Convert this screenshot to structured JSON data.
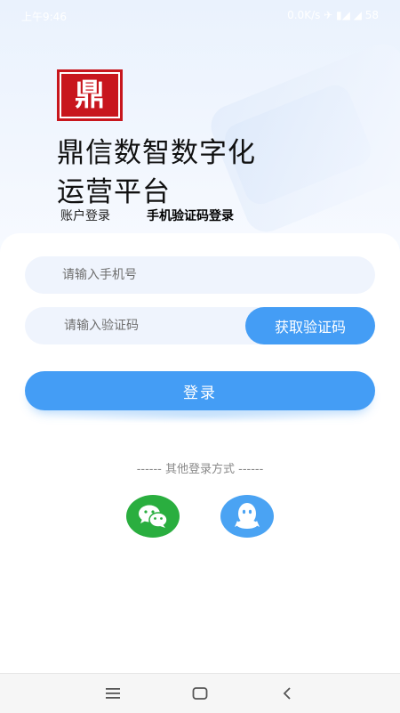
{
  "status_bar": {
    "time": "上午9:46",
    "right": "0.0K/s ✈ ▮◢ ◢ 58"
  },
  "brand": {
    "logo_text": "鼎",
    "title_line1": "鼎信数智数字化",
    "title_line2": "运营平台"
  },
  "tabs": {
    "account": "账户登录",
    "sms": "手机验证码登录"
  },
  "form": {
    "phone_placeholder": "请输入手机号",
    "code_placeholder": "请输入验证码",
    "get_code_label": "获取验证码",
    "login_label": "登录"
  },
  "other_login": {
    "title": "------ 其他登录方式 ------",
    "wechat_icon": "wechat-icon",
    "qq_icon": "qq-icon"
  },
  "colors": {
    "accent": "#449df5",
    "wechat": "#2aae3f",
    "qq": "#4aa3f3",
    "logo": "#c8161d"
  },
  "nav": {
    "menu_icon": "menu-icon",
    "home_icon": "home-icon",
    "back_icon": "back-icon"
  }
}
